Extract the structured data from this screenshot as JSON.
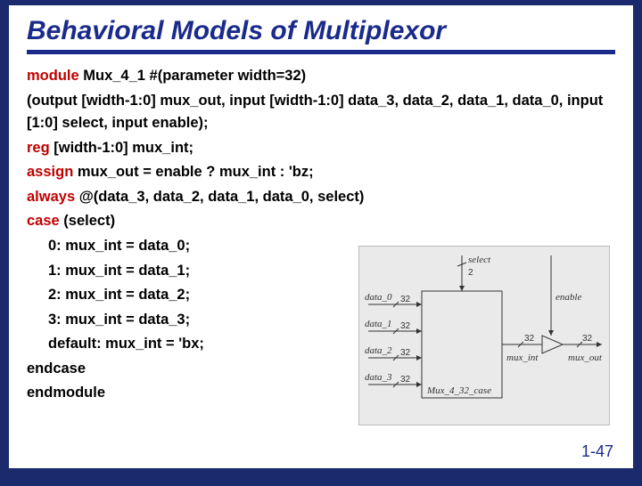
{
  "title": "Behavioral Models of Multiplexor",
  "code": {
    "l1a": "module",
    "l1b": " Mux_4_1 #(parameter width=32)",
    "l2": "(output [width-1:0] mux_out, input [width-1:0] data_3, data_2, data_1, data_0, input [1:0] select, input enable);",
    "l3a": "reg",
    "l3b": " [width-1:0] mux_int;",
    "l4a": "assign",
    "l4b": " mux_out = enable ? mux_int : 'bz;",
    "l5a": "always",
    "l5b": " @(data_3, data_2, data_1, data_0, select)",
    "l6a": "case",
    "l6b": " (select)",
    "l7": "0: mux_int = data_0;",
    "l8": "1: mux_int = data_1;",
    "l9": "2: mux_int = data_2;",
    "l10": "3: mux_int = data_3;",
    "l11": "default: mux_int = 'bx;",
    "l12": "endcase",
    "l13": "endmodule"
  },
  "diagram": {
    "block_name": "Mux_4_32_case",
    "inputs": [
      "data_0",
      "data_1",
      "data_2",
      "data_3"
    ],
    "select": "select",
    "enable": "enable",
    "mux_int": "mux_int",
    "mux_out": "mux_out",
    "bus_width": "32",
    "sel_width": "2"
  },
  "page": "1-47"
}
